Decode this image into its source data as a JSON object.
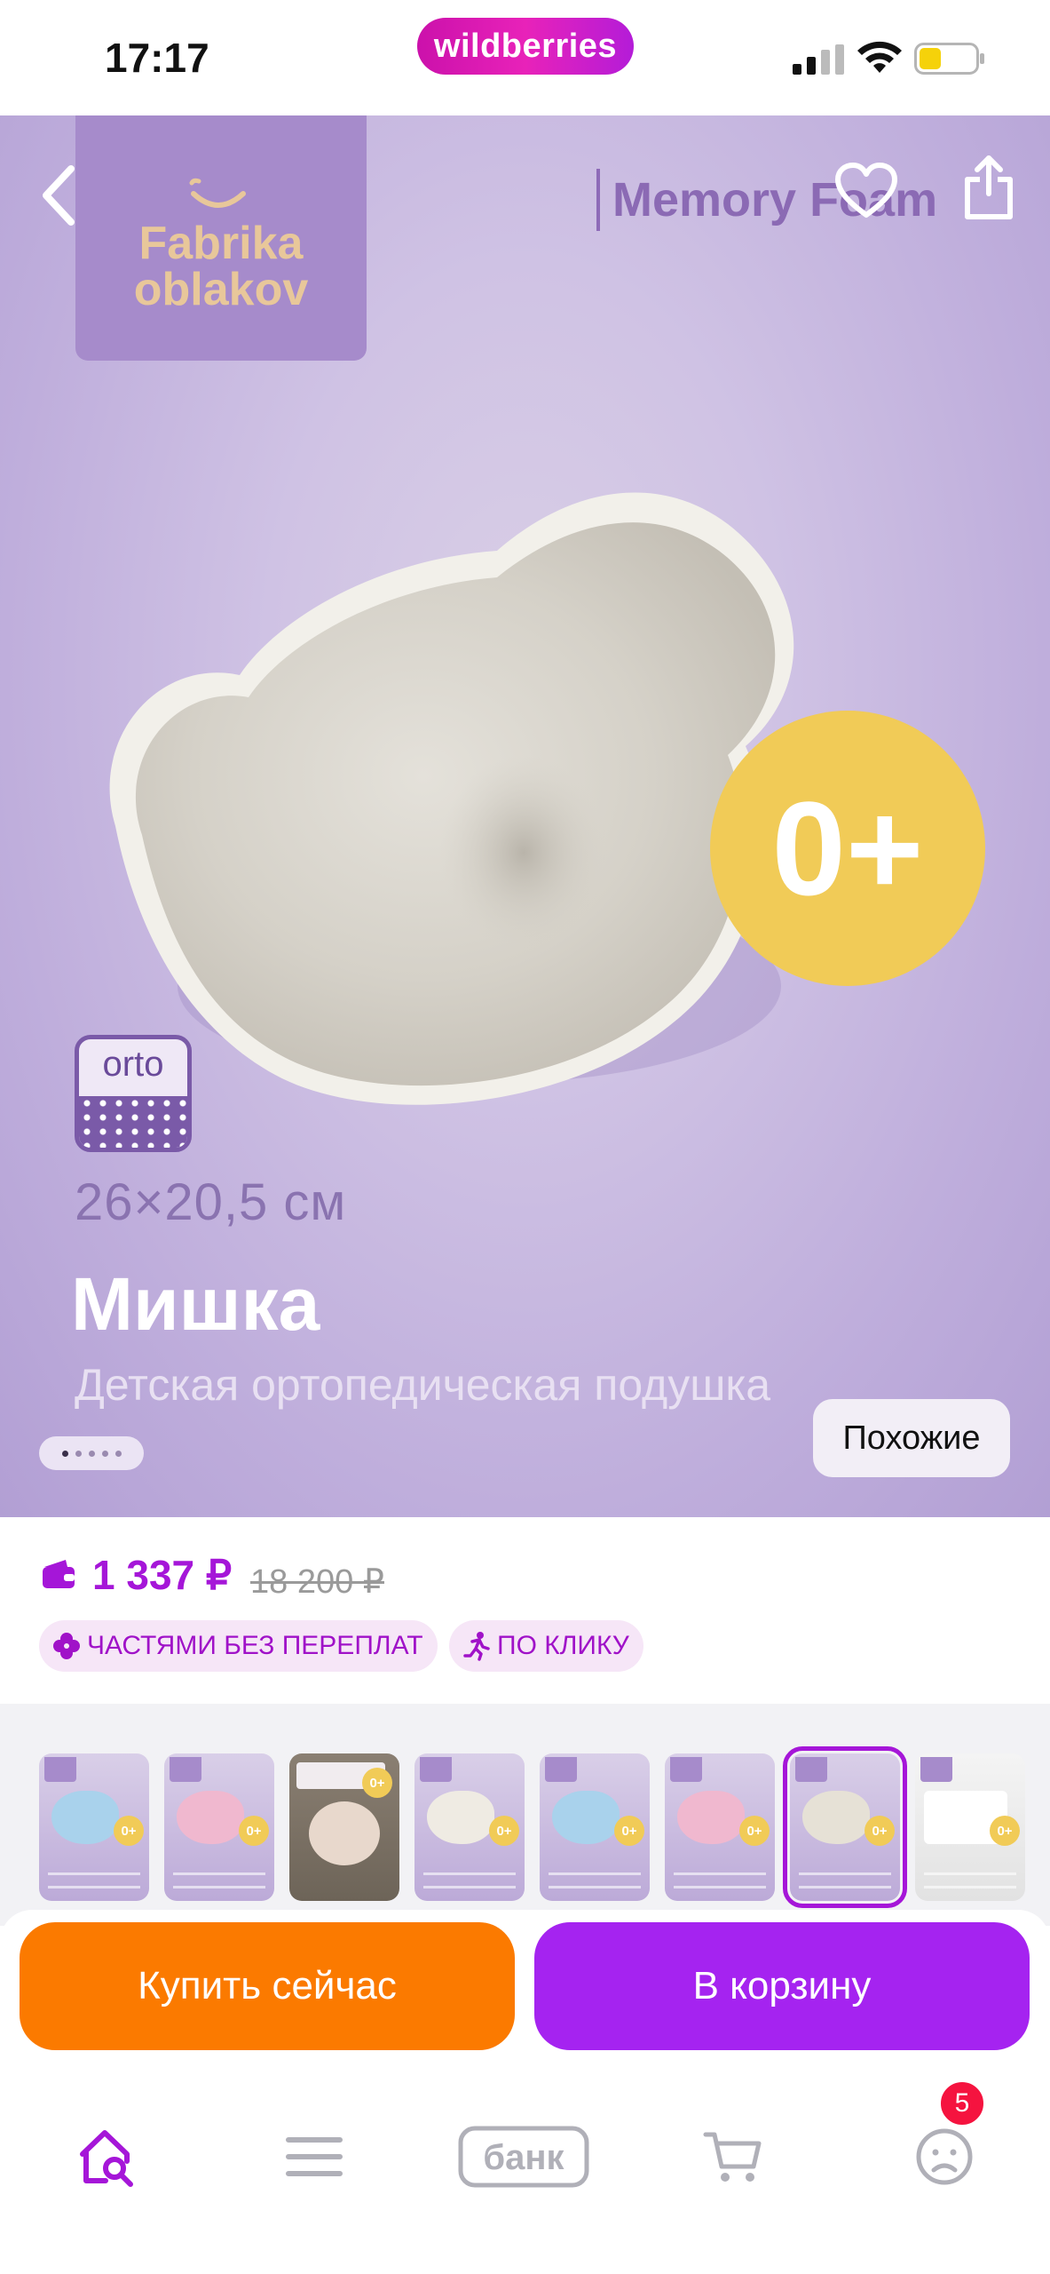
{
  "status_bar": {
    "time": "17:17",
    "brand": "wildberries",
    "icons": [
      "cellular-signal-icon",
      "wifi-icon",
      "battery-low-icon"
    ]
  },
  "hero": {
    "brand_logo": "Fabrika oblakov",
    "brand_logo_line1": "Fabrika",
    "brand_logo_line2": "oblakov",
    "memory_foam": "Memory Foam",
    "age_badge": "0+",
    "orto_label": "orto",
    "size": "26×20,5 см",
    "product_name": "Мишка",
    "product_subtitle": "Детская ортопедическая подушка",
    "gallery_page": 1,
    "gallery_total": 5,
    "similar_button": "Похожие",
    "icons": [
      "back-icon",
      "heart-icon",
      "share-icon"
    ]
  },
  "price": {
    "current": "1 337 ₽",
    "old": "18 200 ₽",
    "chips": [
      {
        "label": "ЧАСТЯМИ БЕЗ ПЕРЕПЛАТ",
        "icon": "clover-icon"
      },
      {
        "label": "ПО КЛИКУ",
        "icon": "running-person-icon"
      }
    ]
  },
  "variants": {
    "selected_index": 6,
    "items": [
      {
        "style": "card",
        "pillow_color": "#a9d2ec",
        "badge": "0+"
      },
      {
        "style": "card",
        "pillow_color": "#f0b8cf",
        "badge": "0+"
      },
      {
        "style": "photo",
        "badge": "0+"
      },
      {
        "style": "card",
        "pillow_color": "#efebe3",
        "badge": "0+"
      },
      {
        "style": "card",
        "pillow_color": "#a9d2ec",
        "badge": "0+"
      },
      {
        "style": "card",
        "pillow_color": "#f0b8cf",
        "badge": "0+"
      },
      {
        "style": "card",
        "pillow_color": "#e6e1d6",
        "badge": "0+"
      },
      {
        "style": "white",
        "badge": "0+"
      }
    ]
  },
  "actions": {
    "buy_now": "Купить сейчас",
    "add_to_cart": "В корзину"
  },
  "tab_bar": {
    "items": [
      "home-search-icon",
      "catalog-menu-icon",
      "bank-icon",
      "cart-icon",
      "profile-icon"
    ],
    "bank_label": "банк",
    "profile_badge": "5",
    "active": "home"
  },
  "colors": {
    "brand_purple": "#a516d8",
    "buy_orange": "#fb7a00",
    "cart_purple": "#a523f0",
    "badge_yellow": "#f1cb57",
    "badge_red": "#f5133f"
  }
}
